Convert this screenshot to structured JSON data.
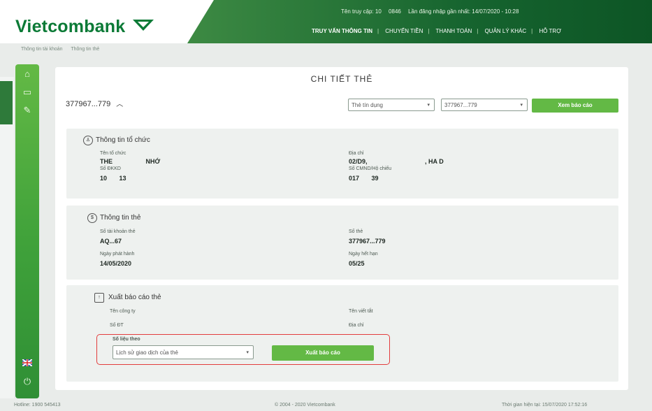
{
  "header": {
    "logo_text": "Vietcombank",
    "top_info": [
      "Tên truy cập: 10",
      "0846",
      "Lần đăng nhập gần nhất: 14/07/2020 - 10:28"
    ],
    "nav": [
      {
        "label": "TRUY VẤN THÔNG TIN",
        "active": true
      },
      {
        "label": "CHUYỂN TIỀN",
        "active": false
      },
      {
        "label": "THANH TOÁN",
        "active": false
      },
      {
        "label": "QUẢN LÝ KHÁC",
        "active": false
      },
      {
        "label": "HỖ TRỢ",
        "active": false
      }
    ]
  },
  "breadcrumb": [
    "Thông tin tài khoản",
    "Thông tin thẻ"
  ],
  "sidebar_icons": [
    "home-icon",
    "card-icon",
    "tools-icon",
    "flag-icon",
    "power-icon"
  ],
  "main": {
    "title": "CHI TIẾT THẺ",
    "card_number": "377967...779",
    "card_type_select": "Thẻ tín dụng",
    "card_number_select": "377967...779",
    "view_report_button": "Xem báo cáo"
  },
  "org_panel": {
    "title": "Thông tin tổ chức",
    "org_name_label": "Tên tổ chức",
    "org_name_value": "THE                   NHỚ",
    "address_label": "Địa chỉ",
    "address_value": "02/D9,                                 , HA D",
    "tax_label": "Số ĐKKD",
    "tax_value": "10       13",
    "id_label": "Số CMND/Hộ chiếu",
    "id_value": "017       39"
  },
  "card_panel": {
    "title": "Thông tin thẻ",
    "account_label": "Số tài khoản thẻ",
    "account_value": "AQ...67",
    "card_no_label": "Số thẻ",
    "card_no_value": "377967...779",
    "issue_label": "Ngày phát hành",
    "issue_value": "14/05/2020",
    "expiry_label": "Ngày hết hạn",
    "expiry_value": "05/25"
  },
  "export_panel": {
    "title": "Xuất báo cáo thẻ",
    "company_label": "Tên công ty",
    "company_value": "Tên viết tắt",
    "phone_label": "Số ĐT",
    "address_label": "Địa chỉ",
    "report_label": "Số liệu theo",
    "report_select": "Lịch sử giao dịch của thẻ",
    "export_button": "Xuất báo cáo"
  },
  "footer": {
    "hotline": "Hotline: 1900 545413",
    "copyright": "© 2004 - 2020 Vietcombank",
    "session": "Thời gian hiện tại: 15/07/2020 17:52:16"
  },
  "colors": {
    "brand": "#0b7a36",
    "accent": "#63b945",
    "highlight": "#e23d3d"
  }
}
